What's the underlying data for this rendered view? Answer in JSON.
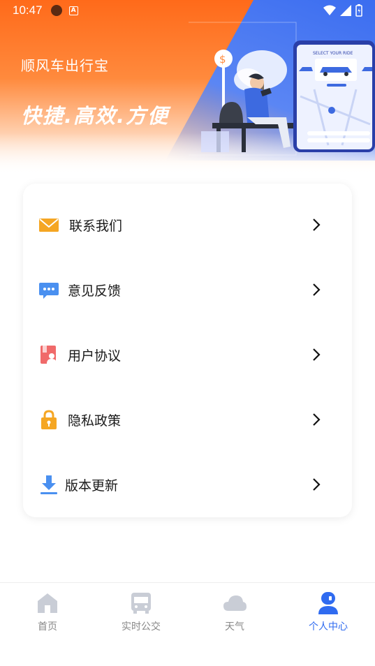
{
  "status_bar": {
    "time": "10:47"
  },
  "header": {
    "app_title": "顺风车出行宝",
    "slogan": "快捷.高效.方便",
    "phone_screen_text": "SELECT YOUR RIDE"
  },
  "menu": {
    "items": [
      {
        "label": "联系我们",
        "icon": "envelope-icon",
        "color": "#f5a623"
      },
      {
        "label": "意见反馈",
        "icon": "chat-bubble-icon",
        "color": "#4a90f0"
      },
      {
        "label": "用户协议",
        "icon": "user-document-icon",
        "color": "#f06a6a"
      },
      {
        "label": "隐私政策",
        "icon": "lock-icon",
        "color": "#f5a623"
      },
      {
        "label": "版本更新",
        "icon": "download-icon",
        "color": "#4a90f0"
      }
    ]
  },
  "bottom_nav": {
    "items": [
      {
        "label": "首页",
        "icon": "home-icon",
        "active": false
      },
      {
        "label": "实时公交",
        "icon": "bus-icon",
        "active": false
      },
      {
        "label": "天气",
        "icon": "cloud-icon",
        "active": false
      },
      {
        "label": "个人中心",
        "icon": "user-icon",
        "active": true
      }
    ]
  },
  "colors": {
    "accent": "#2f6bf0",
    "header_orange": "#ff6a1a",
    "inactive_icon": "#c9cdd6"
  }
}
